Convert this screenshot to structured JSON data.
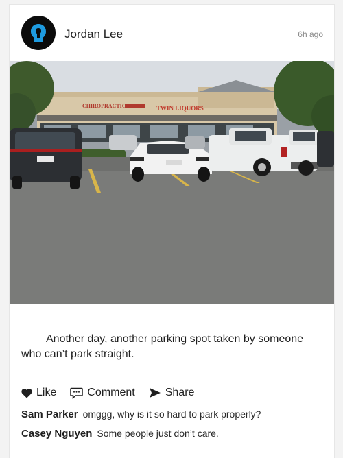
{
  "post": {
    "author": "Jordan Lee",
    "time": "6h ago",
    "avatar_icon": "keyhole-avatar-icon",
    "photo": {
      "description_icon": "parking-lot-photo",
      "sign_text": "TWIN LIQUORS",
      "sign_text_2": "CHIROPRACTIC"
    },
    "caption": "Another day, another parking spot taken by someone who can’t park straight."
  },
  "actions": {
    "like": "Like",
    "comment": "Comment",
    "share": "Share"
  },
  "comments": [
    {
      "name": "Sam Parker",
      "text": "omggg, why is it so hard to park properly?"
    },
    {
      "name": "Casey Nguyen",
      "text": "Some people just don’t care."
    }
  ],
  "colors": {
    "card": "#ffffff",
    "page": "#f3f3f3",
    "avatar": "#0b0b0b",
    "avatar_accent": "#1e9be0"
  }
}
